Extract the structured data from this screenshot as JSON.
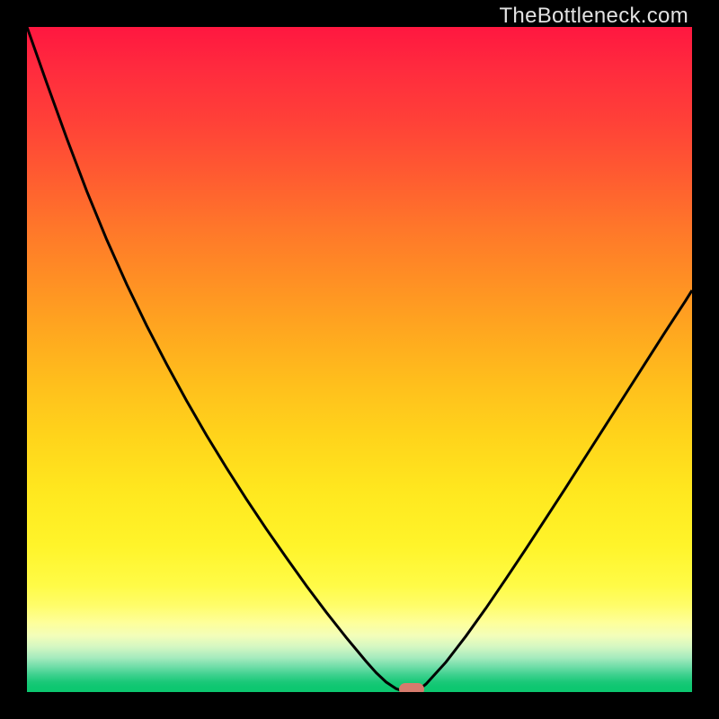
{
  "watermark": {
    "text": "TheBottleneck.com"
  },
  "colors": {
    "accent_marker": "#d67b6d",
    "curve": "#000000",
    "frame": "#000000"
  },
  "chart_data": {
    "type": "line",
    "title": "",
    "xlabel": "",
    "ylabel": "",
    "xlim": [
      0,
      1
    ],
    "ylim": [
      0,
      1
    ],
    "x": [
      0.0,
      0.03,
      0.06,
      0.09,
      0.12,
      0.15,
      0.18,
      0.21,
      0.24,
      0.27,
      0.3,
      0.33,
      0.36,
      0.39,
      0.42,
      0.45,
      0.48,
      0.51,
      0.525,
      0.54,
      0.555,
      0.57,
      0.585,
      0.6,
      0.63,
      0.66,
      0.69,
      0.72,
      0.75,
      0.78,
      0.81,
      0.84,
      0.87,
      0.9,
      0.93,
      0.96,
      0.99,
      1.0
    ],
    "y": [
      1.0,
      0.915,
      0.832,
      0.753,
      0.68,
      0.613,
      0.551,
      0.493,
      0.438,
      0.386,
      0.337,
      0.29,
      0.245,
      0.202,
      0.16,
      0.12,
      0.082,
      0.046,
      0.029,
      0.015,
      0.005,
      0.0,
      0.0,
      0.012,
      0.045,
      0.084,
      0.126,
      0.17,
      0.215,
      0.261,
      0.307,
      0.354,
      0.401,
      0.448,
      0.495,
      0.542,
      0.588,
      0.604
    ],
    "marker": {
      "x": 0.578,
      "y": 0.0
    }
  }
}
